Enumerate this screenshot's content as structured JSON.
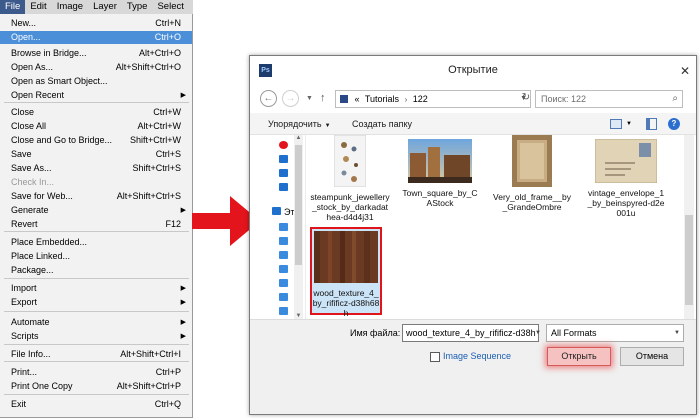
{
  "menubar": {
    "items": [
      {
        "label": "File",
        "active": true
      },
      {
        "label": "Edit",
        "active": false
      },
      {
        "label": "Image",
        "active": false
      },
      {
        "label": "Layer",
        "active": false
      },
      {
        "label": "Type",
        "active": false
      },
      {
        "label": "Select",
        "active": false
      }
    ]
  },
  "file_menu": [
    {
      "label": "New...",
      "shortcut": "Ctrl+N"
    },
    {
      "label": "Open...",
      "shortcut": "Ctrl+O",
      "highlighted": true
    },
    {
      "label": "Browse in Bridge...",
      "shortcut": "Alt+Ctrl+O"
    },
    {
      "label": "Open As...",
      "shortcut": "Alt+Shift+Ctrl+O"
    },
    {
      "label": "Open as Smart Object...",
      "shortcut": ""
    },
    {
      "label": "Open Recent",
      "shortcut": "",
      "submenu": true
    },
    {
      "label": "Close",
      "shortcut": "Ctrl+W"
    },
    {
      "label": "Close All",
      "shortcut": "Alt+Ctrl+W"
    },
    {
      "label": "Close and Go to Bridge...",
      "shortcut": "Shift+Ctrl+W"
    },
    {
      "label": "Save",
      "shortcut": "Ctrl+S"
    },
    {
      "label": "Save As...",
      "shortcut": "Shift+Ctrl+S"
    },
    {
      "label": "Check In...",
      "shortcut": "",
      "disabled": true
    },
    {
      "label": "Save for Web...",
      "shortcut": "Alt+Shift+Ctrl+S"
    },
    {
      "label": "Generate",
      "shortcut": "",
      "submenu": true
    },
    {
      "label": "Revert",
      "shortcut": "F12"
    },
    {
      "label": "Place Embedded...",
      "shortcut": ""
    },
    {
      "label": "Place Linked...",
      "shortcut": ""
    },
    {
      "label": "Package...",
      "shortcut": ""
    },
    {
      "label": "Import",
      "shortcut": "",
      "submenu": true
    },
    {
      "label": "Export",
      "shortcut": "",
      "submenu": true
    },
    {
      "label": "Automate",
      "shortcut": "",
      "submenu": true
    },
    {
      "label": "Scripts",
      "shortcut": "",
      "submenu": true
    },
    {
      "label": "File Info...",
      "shortcut": "Alt+Shift+Ctrl+I"
    },
    {
      "label": "Print...",
      "shortcut": "Ctrl+P"
    },
    {
      "label": "Print One Copy",
      "shortcut": "Alt+Shift+Ctrl+P"
    },
    {
      "label": "Exit",
      "shortcut": "Ctrl+Q"
    }
  ],
  "dialog": {
    "app_icon": "Ps",
    "title": "Открытие",
    "close_glyph": "✕",
    "address": {
      "prefix": "«",
      "segments": [
        "Tutorials",
        "122"
      ]
    },
    "search_placeholder": "Поиск: 122",
    "toolbar": {
      "organize": "Упорядочить",
      "new_folder": "Создать папку"
    },
    "nav_partial_label": "Эт",
    "files": [
      {
        "name": "steampunk_jewellery_stock_by_darkadathea-d4d4j31",
        "thumb": "jewelry",
        "selected": false
      },
      {
        "name": "Town_square_by_CAStock",
        "thumb": "town",
        "selected": false
      },
      {
        "name": "Very_old_frame__by_GrandeOmbre",
        "thumb": "frame",
        "selected": false
      },
      {
        "name": "vintage_envelope_1_by_beinspyred-d2e001u",
        "thumb": "envelope",
        "selected": false
      },
      {
        "name": "wood_texture_4_by_rifificz-d38h68h",
        "thumb": "wood",
        "selected": true
      }
    ],
    "filename_label": "Имя файла:",
    "filename_value": "wood_texture_4_by_rifificz-d38h",
    "format_value": "All Formats",
    "image_sequence_label": "Image Sequence",
    "open_button": "Открыть",
    "cancel_button": "Отмена"
  },
  "colors": {
    "highlight": "#4a8fd8",
    "accent_red": "#e0141b",
    "menu_bg": "#f2f2f2"
  }
}
